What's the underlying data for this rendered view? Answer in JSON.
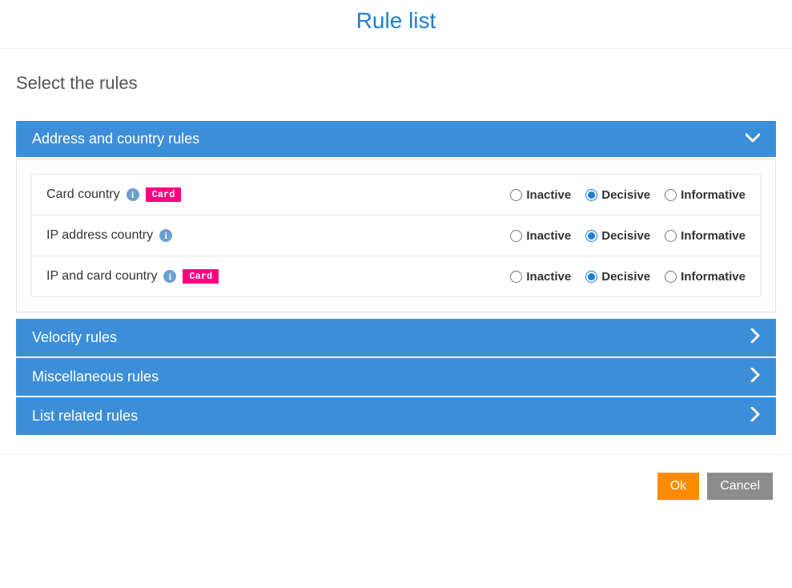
{
  "title": "Rule list",
  "subtitle": "Select the rules",
  "options": {
    "inactive": "Inactive",
    "decisive": "Decisive",
    "informative": "Informative"
  },
  "badges": {
    "card": "Card"
  },
  "sections": [
    {
      "id": "address",
      "label": "Address and country rules",
      "expanded": true,
      "rules": [
        {
          "id": "card-country",
          "label": "Card country",
          "info": true,
          "card_badge": true,
          "selected": "decisive"
        },
        {
          "id": "ip-address",
          "label": "IP address country",
          "info": true,
          "card_badge": false,
          "selected": "decisive"
        },
        {
          "id": "ip-card-country",
          "label": "IP and card country",
          "info": true,
          "card_badge": true,
          "selected": "decisive"
        }
      ]
    },
    {
      "id": "velocity",
      "label": "Velocity rules",
      "expanded": false,
      "rules": []
    },
    {
      "id": "misc",
      "label": "Miscellaneous rules",
      "expanded": false,
      "rules": []
    },
    {
      "id": "list-related",
      "label": "List related rules",
      "expanded": false,
      "rules": []
    }
  ],
  "buttons": {
    "ok": "Ok",
    "cancel": "Cancel"
  }
}
